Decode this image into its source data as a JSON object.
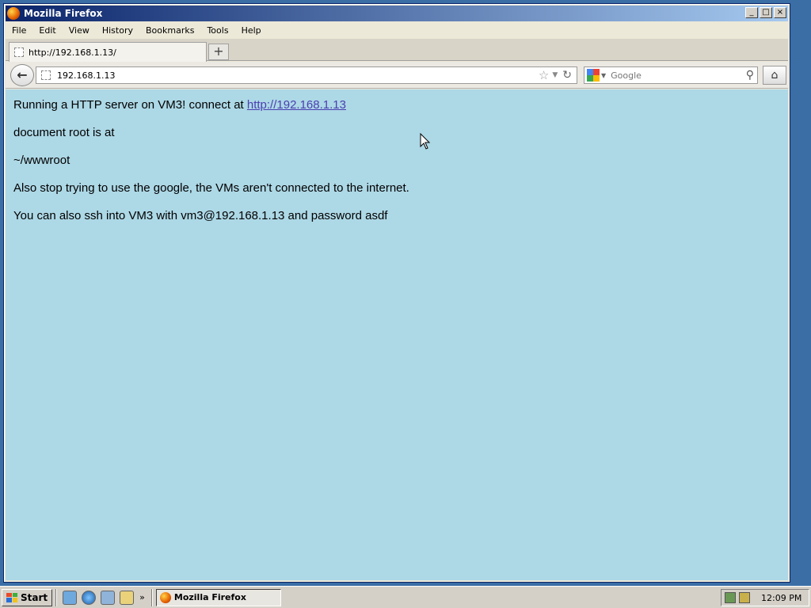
{
  "window": {
    "title": "Mozilla Firefox",
    "controls": {
      "minimize": "_",
      "maximize": "□",
      "close": "×"
    }
  },
  "menu": [
    "File",
    "Edit",
    "View",
    "History",
    "Bookmarks",
    "Tools",
    "Help"
  ],
  "tab": {
    "label": "http://192.168.1.13/",
    "new_tab": "+"
  },
  "nav": {
    "url": "192.168.1.13",
    "search_placeholder": "Google"
  },
  "page": {
    "line1_prefix": "Running a HTTP server on VM3! connect at ",
    "line1_link": "http://192.168.1.13",
    "line2": "document root is at",
    "line3": "~/wwwroot",
    "line4": "Also stop trying to use the google, the VMs aren't connected to the internet.",
    "line5": "You can also ssh into VM3 with vm3@192.168.1.13 and password asdf",
    "background_color": "#add8e6",
    "link_color": "#4b3fb0"
  },
  "taskbar": {
    "start_label": "Start",
    "chevron": "»",
    "task_label": "Mozilla Firefox",
    "clock": "12:09 PM"
  }
}
